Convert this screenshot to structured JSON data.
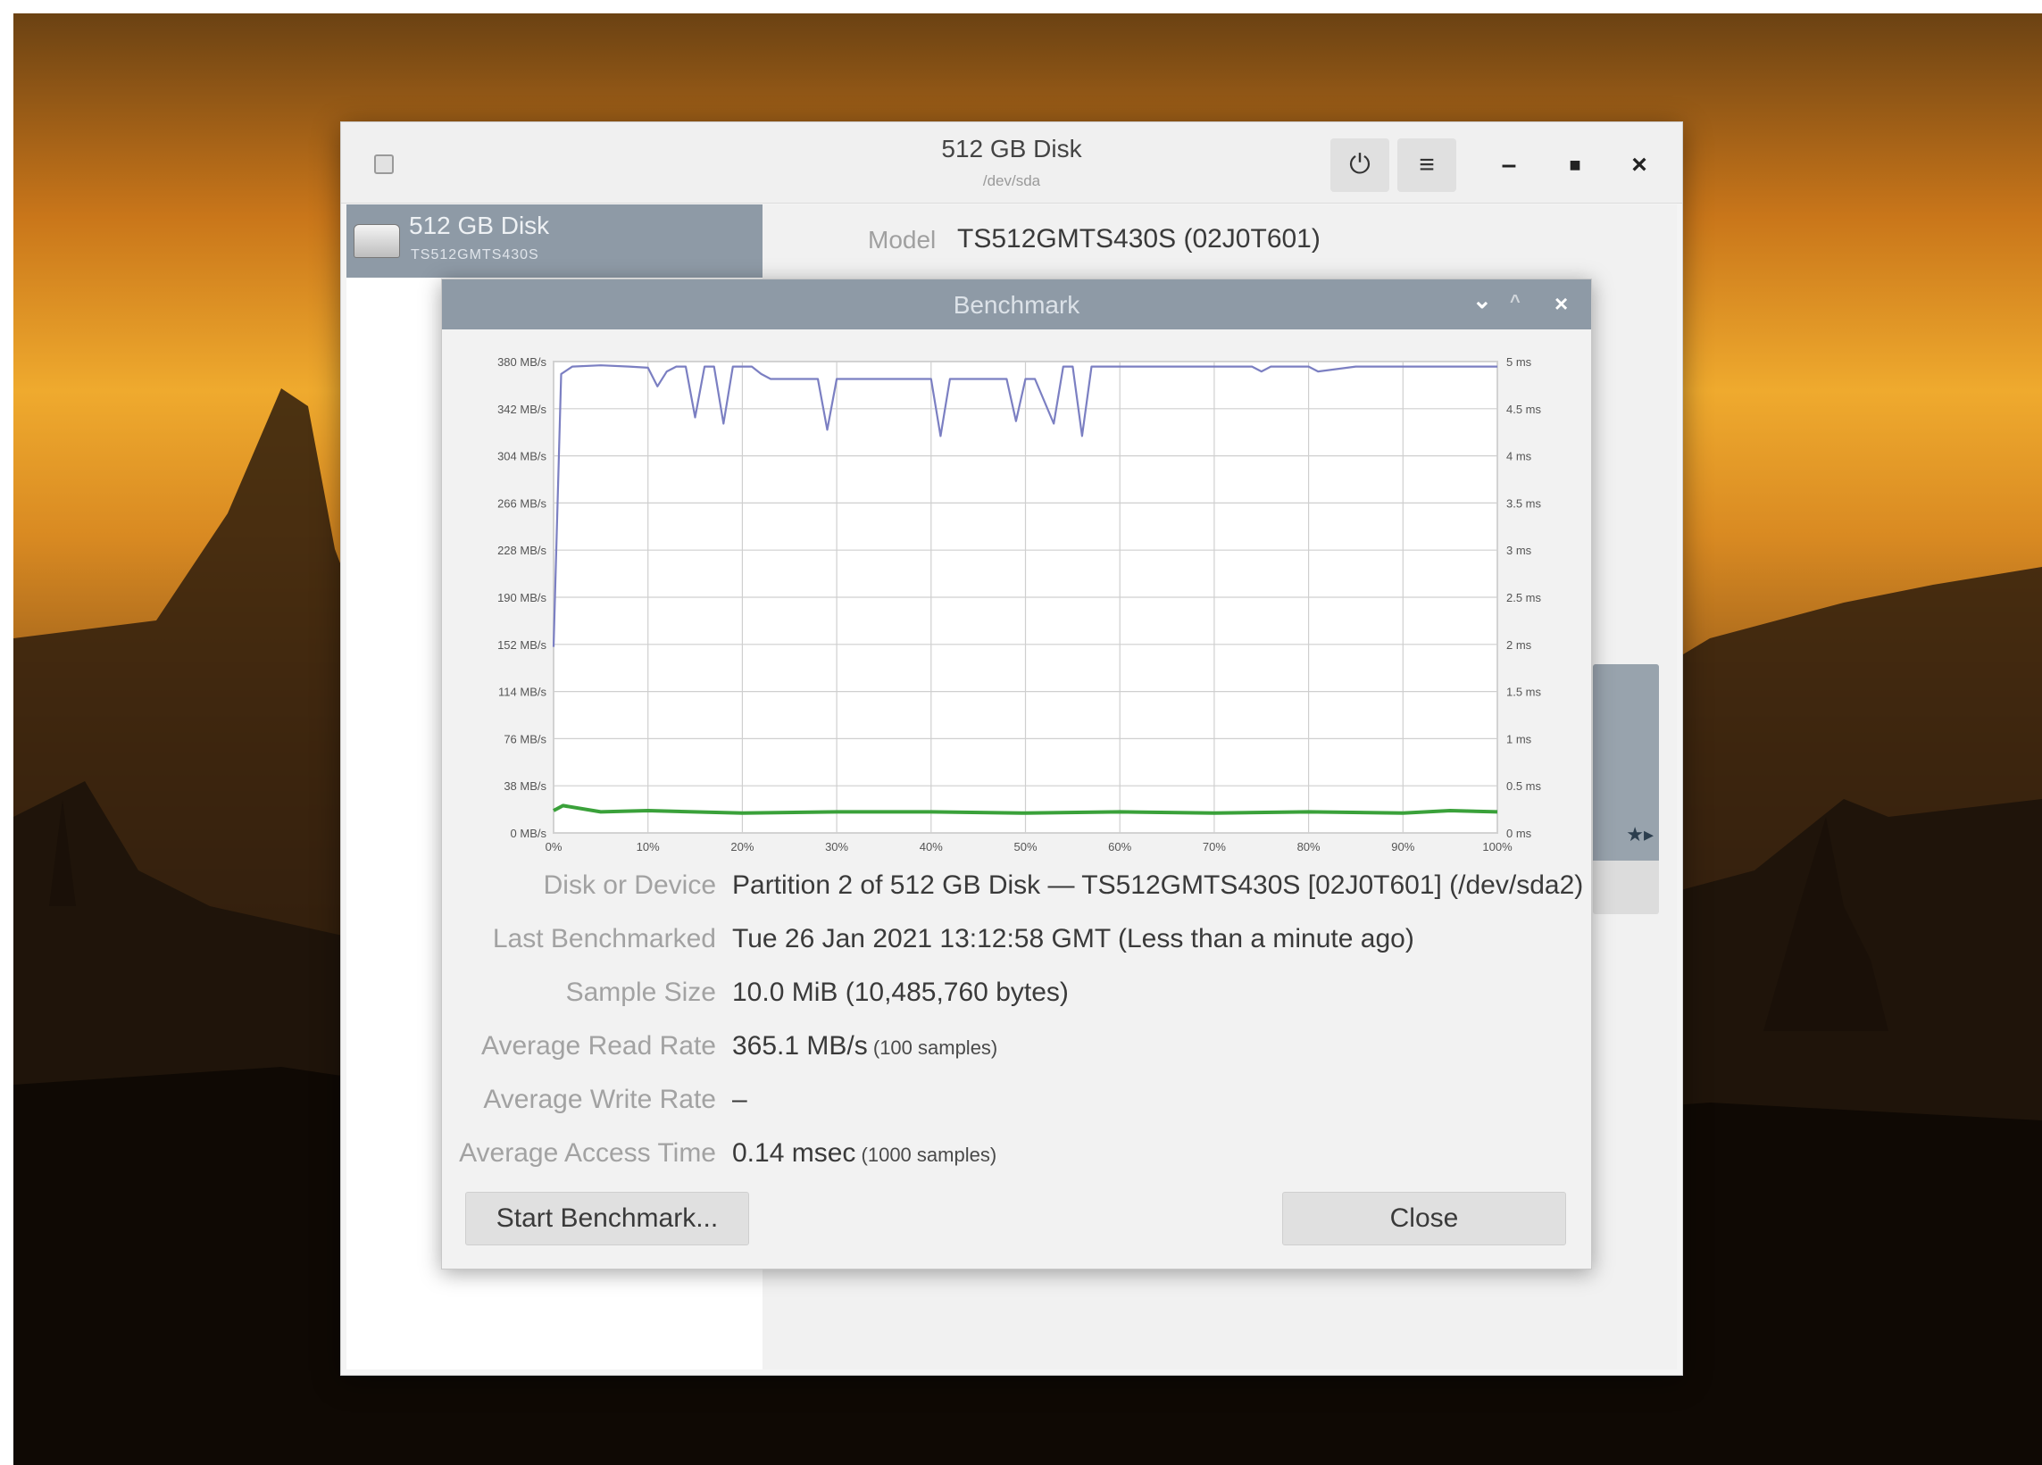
{
  "window": {
    "title": "512 GB Disk",
    "subtitle": "/dev/sda",
    "power_icon": "power-icon",
    "menu_icon": "hamburger-menu-icon"
  },
  "sidebar": {
    "items": [
      {
        "name": "512 GB Disk",
        "model": "TS512GMTS430S",
        "icon": "drive-icon"
      }
    ]
  },
  "details": {
    "model_label": "Model",
    "model_value": "TS512GMTS430S (02J0T601)"
  },
  "benchmark": {
    "title": "Benchmark",
    "rows": [
      {
        "label": "Disk or Device",
        "value": "Partition 2 of 512 GB Disk — TS512GMTS430S [02J0T601] (/dev/sda2)",
        "note": ""
      },
      {
        "label": "Last Benchmarked",
        "value": "Tue 26 Jan 2021 13:12:58 GMT (Less than a minute ago)",
        "note": ""
      },
      {
        "label": "Sample Size",
        "value": "10.0 MiB (10,485,760 bytes)",
        "note": ""
      },
      {
        "label": "Average Read Rate",
        "value": "365.1 MB/s",
        "note": "(100 samples)"
      },
      {
        "label": "Average Write Rate",
        "value": "–",
        "note": ""
      },
      {
        "label": "Average Access Time",
        "value": "0.14 msec",
        "note": "(1000 samples)"
      }
    ],
    "start_button": "Start Benchmark...",
    "close_button": "Close"
  },
  "chart_data": {
    "type": "line",
    "x_ticks": [
      "0%",
      "10%",
      "20%",
      "30%",
      "40%",
      "50%",
      "60%",
      "70%",
      "80%",
      "90%",
      "100%"
    ],
    "y_left_ticks": [
      "380 MB/s",
      "342 MB/s",
      "304 MB/s",
      "266 MB/s",
      "228 MB/s",
      "190 MB/s",
      "152 MB/s",
      "114 MB/s",
      "76 MB/s",
      "38 MB/s",
      "0 MB/s"
    ],
    "y_right_ticks": [
      "5 ms",
      "4.5 ms",
      "4 ms",
      "3.5 ms",
      "3 ms",
      "2.5 ms",
      "2 ms",
      "1.5 ms",
      "1 ms",
      "0.5 ms",
      "0 ms"
    ],
    "xlim": [
      0,
      100
    ],
    "ylim": [
      0,
      380
    ],
    "grid": true,
    "series": [
      {
        "color": "#7b7fc2",
        "x": [
          0,
          0.8,
          2,
          5,
          8,
          10,
          11,
          12,
          13,
          14,
          15,
          16,
          17,
          18,
          19,
          20,
          21,
          22,
          23,
          24,
          25,
          26,
          27,
          28,
          29,
          30,
          31,
          33,
          36,
          40,
          41,
          42,
          43,
          45,
          48,
          49,
          50,
          51,
          53,
          54,
          55,
          56,
          57,
          58,
          59,
          60,
          62,
          65,
          70,
          74,
          75,
          76,
          80,
          81,
          85,
          90,
          95,
          99,
          100
        ],
        "values": [
          150,
          370,
          376,
          377,
          376,
          375,
          360,
          372,
          376,
          376,
          335,
          376,
          376,
          330,
          376,
          376,
          376,
          370,
          366,
          366,
          366,
          366,
          366,
          366,
          325,
          366,
          366,
          366,
          366,
          366,
          320,
          366,
          366,
          366,
          366,
          332,
          366,
          366,
          330,
          376,
          376,
          320,
          376,
          376,
          376,
          376,
          376,
          376,
          376,
          376,
          372,
          376,
          376,
          372,
          376,
          376,
          376,
          376,
          376
        ]
      },
      {
        "color": "#3aa13a",
        "x": [
          0,
          1,
          5,
          10,
          20,
          30,
          40,
          50,
          60,
          70,
          80,
          90,
          95,
          100
        ],
        "values": [
          18,
          22,
          17,
          18,
          16,
          17,
          17,
          16,
          17,
          16,
          17,
          16,
          18,
          17
        ]
      }
    ]
  }
}
